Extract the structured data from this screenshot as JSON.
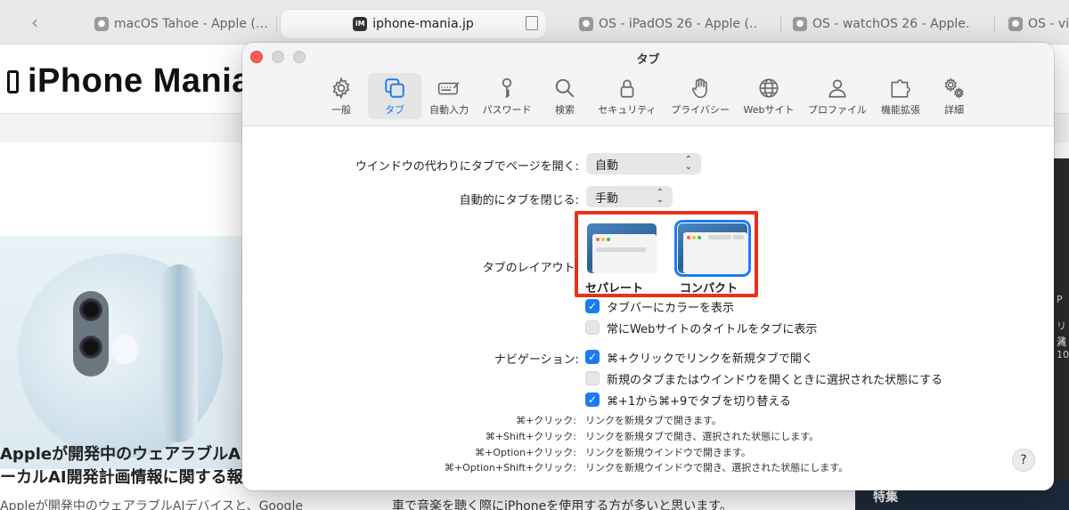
{
  "browser": {
    "tabs": [
      {
        "label": "macOS Tahoe - Apple (…",
        "favicon": "apple-icon"
      },
      {
        "label": "iphone-mania.jp",
        "favicon": "iM"
      },
      {
        "label": "OS - iPadOS 26 - Apple (…",
        "favicon": "apple-icon"
      },
      {
        "label": "OS - watchOS 26 - Apple…",
        "favicon": "apple-icon"
      },
      {
        "label": "OS - vis",
        "favicon": "apple-icon"
      }
    ]
  },
  "site": {
    "logo": "iPhone Mania",
    "article_title_1": "Appleが開発中のウェアラブルA",
    "article_title_2": "ーカルAI開発計画情報に関する報",
    "article_desc": "Appleが開発中のウェアラブルAIデバイスと、Google",
    "right_desc": "車で音楽を聴く際にiPhoneを使用する方が多いと思います。",
    "right_fragments": [
      "P",
      "リス",
      "減10"
    ],
    "bottom_label": "特集"
  },
  "prefs": {
    "title": "タブ",
    "tabs": [
      {
        "label": "一般",
        "icon": "gear-icon"
      },
      {
        "label": "タブ",
        "icon": "tabs-icon"
      },
      {
        "label": "自動入力",
        "icon": "autofill-icon"
      },
      {
        "label": "パスワード",
        "icon": "key-icon"
      },
      {
        "label": "検索",
        "icon": "search-icon"
      },
      {
        "label": "セキュリティ",
        "icon": "lock-icon"
      },
      {
        "label": "プライバシー",
        "icon": "hand-icon"
      },
      {
        "label": "Webサイト",
        "icon": "globe-icon"
      },
      {
        "label": "プロファイル",
        "icon": "person-icon"
      },
      {
        "label": "機能拡張",
        "icon": "puzzle-icon"
      },
      {
        "label": "詳細",
        "icon": "gears-icon"
      }
    ],
    "selected_tab": "タブ",
    "open_pages_label": "ウインドウの代わりにタブでページを開く:",
    "open_pages_value": "自動",
    "auto_close_label": "自動的にタブを閉じる:",
    "auto_close_value": "手動",
    "layout_label": "タブのレイアウト:",
    "layout_separate": "セパレート",
    "layout_compact": "コンパクト",
    "tab_options": [
      {
        "label": "タブバーにカラーを表示",
        "checked": true
      },
      {
        "label": "常にWebサイトのタイトルをタブに表示",
        "checked": false
      }
    ],
    "nav_label": "ナビゲーション:",
    "nav_options": [
      {
        "label": "⌘+クリックでリンクを新規タブで開く",
        "checked": true
      },
      {
        "label": "新規のタブまたはウインドウを開くときに選択された状態にする",
        "checked": false
      },
      {
        "label": "⌘+1から⌘+9でタブを切り替える",
        "checked": true
      }
    ],
    "shortcuts": [
      {
        "key": "⌘+クリック:",
        "desc": "リンクを新規タブで開きます。"
      },
      {
        "key": "⌘+Shift+クリック:",
        "desc": "リンクを新規タブで開き、選択された状態にします。"
      },
      {
        "key": "⌘+Option+クリック:",
        "desc": "リンクを新規ウインドウで開きます。"
      },
      {
        "key": "⌘+Option+Shift+クリック:",
        "desc": "リンクを新規ウインドウで開き、選択された状態にします。"
      }
    ],
    "help": "?"
  },
  "colors": {
    "accent": "#1a7cf5",
    "highlight_box": "#e8321e",
    "close_light": "#ff5f57"
  }
}
